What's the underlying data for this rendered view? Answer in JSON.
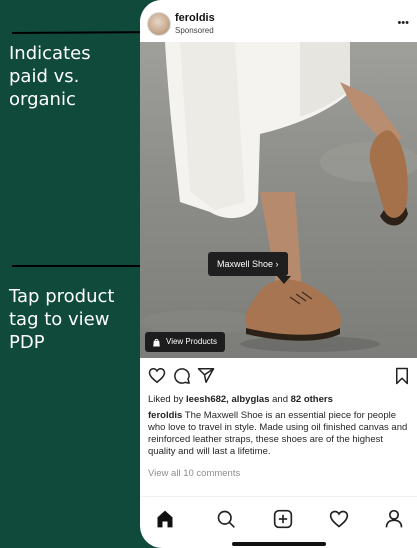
{
  "annotations": {
    "paid_vs_organic": "Indicates\npaid vs.\norganic",
    "product_tag": "Tap product\ntag to view\nPDP"
  },
  "post": {
    "username": "feroldis",
    "sponsored_label": "Sponsored",
    "product_tag_label": "Maxwell Shoe ›",
    "view_products_label": "View Products",
    "likes": {
      "prefix": "Liked by ",
      "users": "leesh682, albyglas",
      "middle": " and ",
      "count": "82 others"
    },
    "caption_user": "feroldis",
    "caption_text": " The Maxwell Shoe is an essential piece for people who love to travel in style. Made using oil finished canvas and reinforced leather straps, these shoes are of the highest quality and will last a lifetime.",
    "view_comments": "View all 10 comments"
  },
  "icons": {
    "more": "more-horizontal-icon",
    "like": "heart-icon",
    "comment": "comment-icon",
    "share": "send-icon",
    "save": "bookmark-icon",
    "home": "home-icon",
    "search": "search-icon",
    "create": "plus-square-icon",
    "activity": "heart-icon",
    "profile": "profile-icon"
  },
  "colors": {
    "background": "#0f4a3a",
    "annotation_text": "#ffffff",
    "tag_background": "#1f1f1f"
  }
}
